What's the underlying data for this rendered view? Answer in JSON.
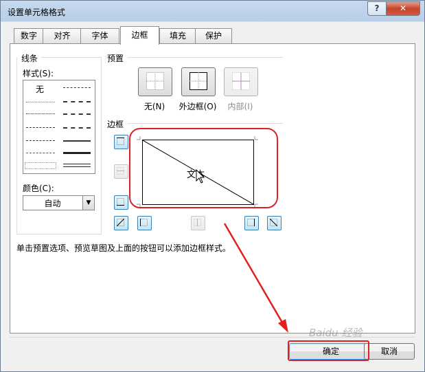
{
  "window": {
    "title": "设置单元格格式",
    "help_label": "?",
    "close_label": "✕"
  },
  "tabs": [
    {
      "label": "数字",
      "active": false
    },
    {
      "label": "对齐",
      "active": false
    },
    {
      "label": "字体",
      "active": false
    },
    {
      "label": "边框",
      "active": true
    },
    {
      "label": "填充",
      "active": false
    },
    {
      "label": "保护",
      "active": false
    }
  ],
  "line": {
    "group_label": "线条",
    "style_label": "样式(S):",
    "none_label": "无",
    "color_label": "颜色(C):",
    "color_value": "自动"
  },
  "presets": {
    "group_label": "预置",
    "items": [
      {
        "label": "无(N)",
        "enabled": true
      },
      {
        "label": "外边框(O)",
        "enabled": true
      },
      {
        "label": "内部(I)",
        "enabled": false
      }
    ]
  },
  "border": {
    "group_label": "边框",
    "preview_text": "文本"
  },
  "hint": "单击预置选项、预览草图及上面的按钮可以添加边框样式。",
  "buttons": {
    "ok": "确定",
    "cancel": "取消"
  },
  "watermark": "Baidu 经验",
  "colors": {
    "highlight_red": "#e02020",
    "border_button": "#3c7fb1",
    "title_gradient": "#c6d9ef"
  },
  "icons": [
    "help-icon",
    "close-icon",
    "dropdown-arrow-icon",
    "mouse-cursor-icon"
  ]
}
